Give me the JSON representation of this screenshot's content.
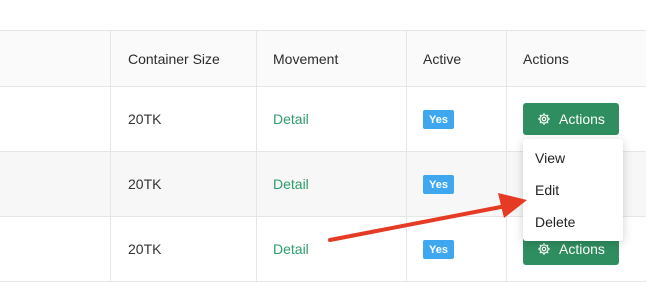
{
  "table": {
    "headers": {
      "size": "Container Size",
      "movement": "Movement",
      "active": "Active",
      "actions": "Actions"
    },
    "rows": [
      {
        "size": "20TK",
        "movement": "Detail",
        "active": "Yes",
        "actions": "Actions"
      },
      {
        "size": "20TK",
        "movement": "Detail",
        "active": "Yes"
      },
      {
        "size": "20TK",
        "movement": "Detail",
        "active": "Yes",
        "actions": "Actions"
      }
    ]
  },
  "dropdown": {
    "items": [
      "View",
      "Edit",
      "Delete"
    ]
  },
  "icons": {
    "action_icon": "gear-icon"
  },
  "colors": {
    "link": "#2e9d6b",
    "badge": "#3ea7f0",
    "action_button": "#2f8e5f",
    "arrow": "#e53a24"
  }
}
